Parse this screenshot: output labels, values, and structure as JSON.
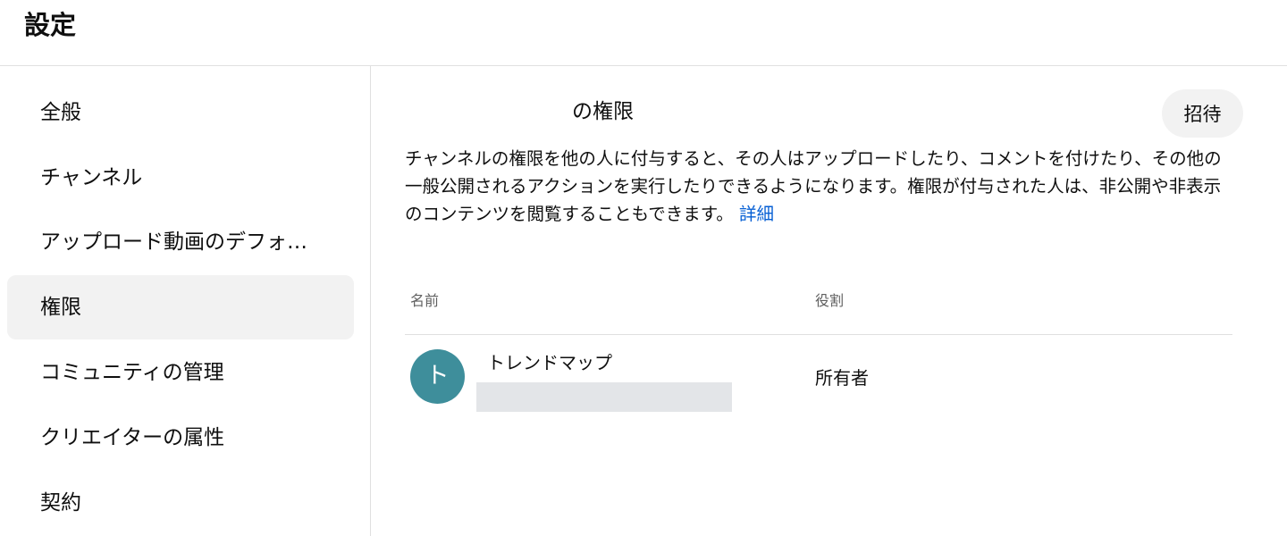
{
  "header": {
    "title": "設定"
  },
  "sidebar": {
    "items": [
      {
        "label": "全般"
      },
      {
        "label": "チャンネル"
      },
      {
        "label": "アップロード動画のデフォルト設定"
      },
      {
        "label": "権限"
      },
      {
        "label": "コミュニティの管理"
      },
      {
        "label": "クリエイターの属性"
      },
      {
        "label": "契約"
      }
    ],
    "active_index": 3
  },
  "main": {
    "section_title": "の権限",
    "invite_label": "招待",
    "description": "チャンネルの権限を他の人に付与すると、その人はアップロードしたり、コメントを付けたり、その他の一般公開されるアクションを実行したりできるようになります。権限が付与された人は、非公開や非表示のコンテンツを閲覧することもできます。",
    "details_link": "詳細",
    "table": {
      "columns": [
        "名前",
        "役割"
      ],
      "rows": [
        {
          "avatar_initial": "ト",
          "name": "トレンドマップ",
          "role": "所有者"
        }
      ]
    }
  },
  "colors": {
    "avatar": "#3e8e9b",
    "link": "#065fd4",
    "active_item": "#f2f2f2",
    "redacted": "#e3e5e8"
  }
}
